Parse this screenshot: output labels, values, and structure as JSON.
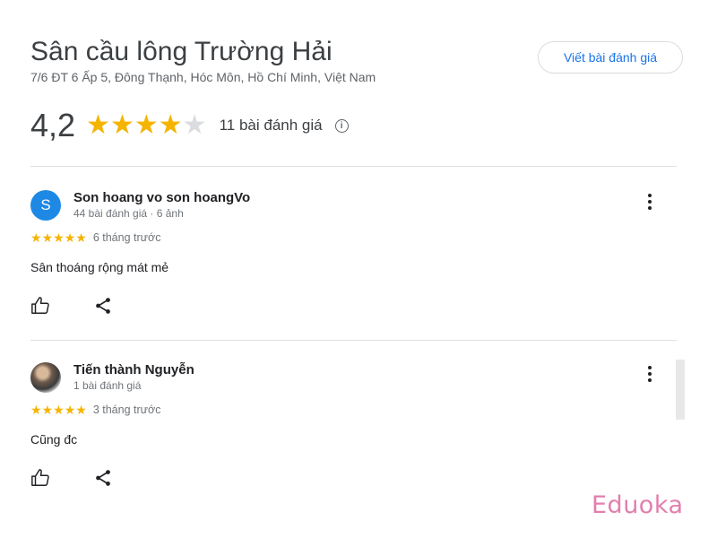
{
  "place": {
    "name": "Sân cầu lông Trường Hải",
    "address": "7/6 ĐT 6 Ấp 5, Đông Thạnh, Hóc Môn, Hồ Chí Minh, Việt Nam",
    "write_review_label": "Viết bài đánh giá",
    "rating": "4,2",
    "rating_stars": 4,
    "review_count": "11 bài đánh giá",
    "info_icon": "info-icon"
  },
  "reviews": [
    {
      "avatar_letter": "S",
      "name": "Son hoang vo son hoangVo",
      "meta": "44 bài đánh giá · 6 ảnh",
      "stars": 5,
      "time": "6 tháng trước",
      "text": "Sân thoáng rộng mát mẻ"
    },
    {
      "avatar_letter": "",
      "name": "Tiến thành Nguyễn",
      "meta": "1 bài đánh giá",
      "stars": 5,
      "time": "3 tháng trước",
      "text": "Cũng đc"
    }
  ],
  "watermark": "Eduoka",
  "colors": {
    "star": "#f5b400",
    "star_empty": "#dadce0",
    "link": "#1a73e8",
    "avatar": "#1e88e5",
    "watermark": "#e27fae"
  }
}
